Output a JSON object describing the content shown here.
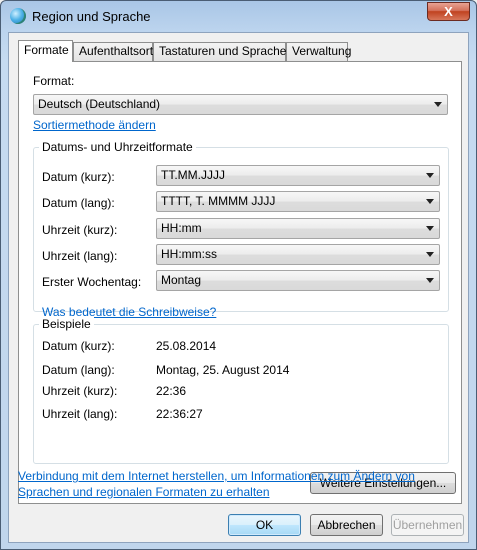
{
  "window": {
    "title": "Region und Sprache",
    "close_label": "X",
    "icon": "globe-icon"
  },
  "tabs": [
    {
      "label": "Formate",
      "active": true
    },
    {
      "label": "Aufenthaltsort",
      "active": false
    },
    {
      "label": "Tastaturen und Sprachen",
      "active": false
    },
    {
      "label": "Verwaltung",
      "active": false
    }
  ],
  "format": {
    "label": "Format:",
    "value": "Deutsch (Deutschland)",
    "sort_link": "Sortiermethode ändern"
  },
  "datetime_group": {
    "title": "Datums- und Uhrzeitformate",
    "rows": [
      {
        "label": "Datum (kurz):",
        "value": "TT.MM.JJJJ"
      },
      {
        "label": "Datum (lang):",
        "value": "TTTT, T. MMMM JJJJ"
      },
      {
        "label": "Uhrzeit (kurz):",
        "value": "HH:mm"
      },
      {
        "label": "Uhrzeit (lang):",
        "value": "HH:mm:ss"
      },
      {
        "label": "Erster Wochentag:",
        "value": "Montag"
      }
    ],
    "notation_link": "Was bedeutet die Schreibweise?"
  },
  "examples_group": {
    "title": "Beispiele",
    "rows": [
      {
        "label": "Datum (kurz):",
        "value": "25.08.2014"
      },
      {
        "label": "Datum (lang):",
        "value": "Montag, 25. August 2014"
      },
      {
        "label": "Uhrzeit (kurz):",
        "value": "22:36"
      },
      {
        "label": "Uhrzeit (lang):",
        "value": "22:36:27"
      }
    ]
  },
  "more_settings_button": "Weitere Einstellungen...",
  "internet_link": {
    "line1": "Verbindung mit dem Internet herstellen, um Informationen zum Ändern von",
    "line2": "Sprachen und regionalen Formaten zu erhalten"
  },
  "buttons": {
    "ok": "OK",
    "cancel": "Abbrechen",
    "apply": "Übernehmen"
  }
}
